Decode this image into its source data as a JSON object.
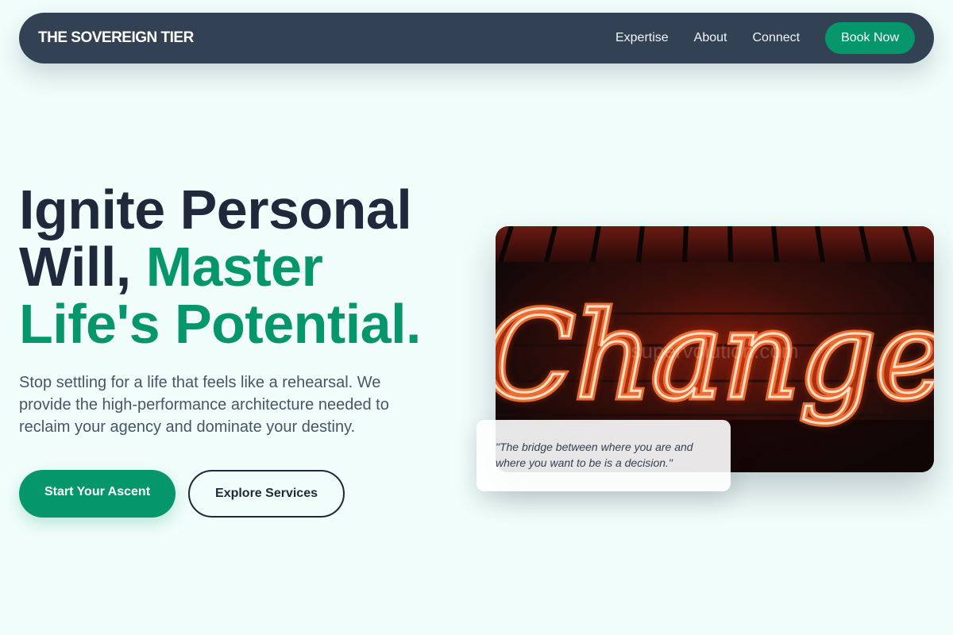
{
  "brand": "THE SOVEREIGN TIER",
  "nav": {
    "links": [
      "Expertise",
      "About",
      "Connect"
    ],
    "cta": "Book Now"
  },
  "hero": {
    "title_line1": "Ignite Personal",
    "title_will": "Will, ",
    "title_master": "Master",
    "title_line3": "Life's Potential.",
    "subtitle": "Stop settling for a life that feels like a rehearsal. We provide the high-performance architecture needed to reclaim your agency and dominate your destiny.",
    "primary_cta": "Start Your Ascent",
    "secondary_cta": "Explore Services"
  },
  "image": {
    "neon_text": "Change",
    "watermark": "supervolution.com"
  },
  "quote": "\"The bridge between where you are and where you want to be is a decision.\"",
  "colors": {
    "background": "#f0fdfa",
    "nav": "#334155",
    "accent": "#059669",
    "heading": "#1e293b",
    "body_text": "#475569"
  }
}
